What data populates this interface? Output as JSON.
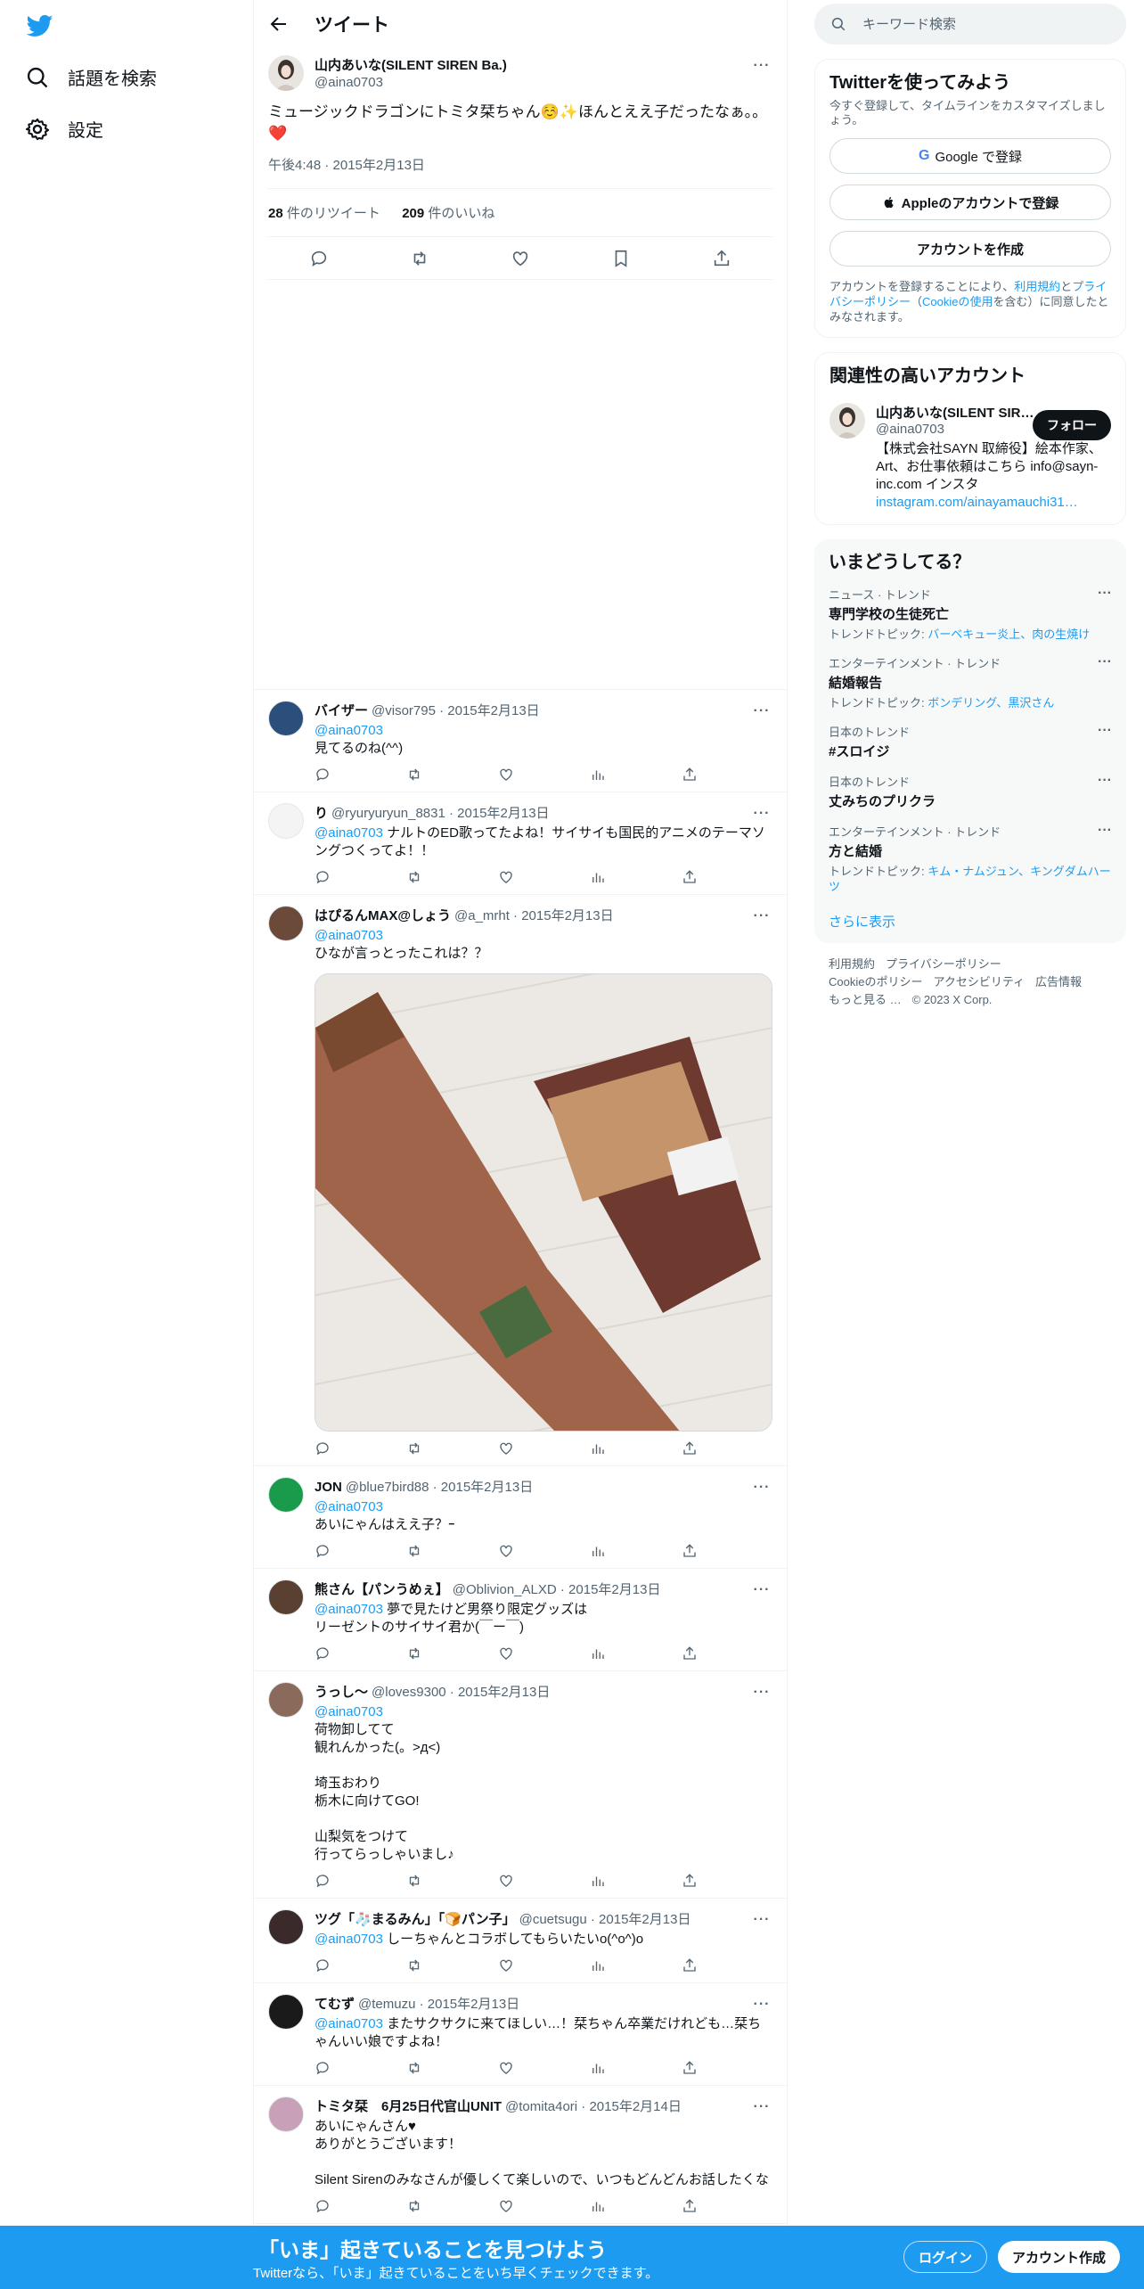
{
  "colors": {
    "accent": "#1d9bf0",
    "text": "#0f1419",
    "secondary": "#536471",
    "border": "#eff3f4"
  },
  "left_nav": {
    "logo": "twitter-bird-icon",
    "items": [
      {
        "label": "話題を検索",
        "icon": "search-icon"
      },
      {
        "label": "設定",
        "icon": "gear-icon"
      }
    ]
  },
  "header": {
    "title": "ツイート"
  },
  "focal_tweet": {
    "name": "山内あいな(SILENT SIREN Ba.)",
    "handle": "@aina0703",
    "text": "ミュージックドラゴンにトミタ栞ちゃん☺️✨ほんとええ子だったなぁ。。❤️",
    "time": "午後4:48 · 2015年2月13日",
    "retweets": "28",
    "retweets_label": " 件のリツイート",
    "likes": "209",
    "likes_label": " 件のいいね"
  },
  "replies": [
    {
      "name": "バイザー",
      "meta": "@visor795 · 2015年2月13日",
      "mention": "@aina0703",
      "text": "見てるのね(^^)",
      "inline": false
    },
    {
      "name": "り",
      "meta": "@ryuryuryun_8831 · 2015年2月13日",
      "mention": "@aina0703",
      "text": " ナルトのED歌ってたよね！サイサイも国民的アニメのテーマソングつくってよ！！",
      "inline": true
    },
    {
      "name": "はぴるんMAX@しょう",
      "meta": "@a_mrht · 2015年2月13日",
      "mention": "@aina0703",
      "text": "ひなが言っとったこれは？？",
      "inline": false,
      "has_photo": true
    },
    {
      "name": "JON",
      "meta": "@blue7bird88 · 2015年2月13日",
      "mention": "@aina0703",
      "text": "あいにゃんはええ子？ｰ",
      "inline": false
    },
    {
      "name": "熊さん【パンうめぇ】",
      "meta": "@Oblivion_ALXD · 2015年2月13日",
      "mention": "@aina0703",
      "text": " 夢で見たけど男祭り限定グッズは\nリーゼントのサイサイ君か(￣ー￣)",
      "inline": true
    },
    {
      "name": "うっし～",
      "meta": "@loves9300 · 2015年2月13日",
      "mention": "@aina0703",
      "text": "荷物卸してて\n観れんかった(。>д<)\n\n埼玉おわり\n栃木に向けてGO!\n\n山梨気をつけて\n行ってらっしゃいまし♪",
      "inline": false
    },
    {
      "name": "ツグ「🧦まるみん」「🍞パン子」",
      "meta": "@cuetsugu · 2015年2月13日",
      "mention": "@aina0703",
      "text": " しーちゃんとコラボしてもらいたいo(^o^)o",
      "inline": true
    },
    {
      "name": "てむず",
      "meta": "@temuzu · 2015年2月13日",
      "mention": "@aina0703",
      "text": " またサクサクに来てほしい…！栞ちゃん卒業だけれども…栞ちゃんいい娘ですよね！",
      "inline": true
    },
    {
      "name": "トミタ栞　6月25日代官山UNIT",
      "meta": "@tomita4ori · 2015年2月14日",
      "mention": "",
      "text": "あいにゃんさん♥\nありがとうございます！\n\nSilent Sirenのみなさんが優しくて楽しいので、いつもどんどんお話したくな",
      "inline": false
    }
  ],
  "search": {
    "placeholder": "キーワード検索"
  },
  "signup_card": {
    "title": "Twitterを使ってみよう",
    "subtitle": "今すぐ登録して、タイムラインをカスタマイズしましょう。",
    "google": "Google で登録",
    "apple": "Appleのアカウントで登録",
    "create": "アカウントを作成",
    "terms_pre": "アカウントを登録することにより、",
    "terms_link1": "利用規約",
    "terms_and": "と",
    "terms_link2": "プライバシーポリシー",
    "terms_paren_open": "（",
    "terms_link3": "Cookieの使用",
    "terms_post": "を含む）に同意したとみなされます。"
  },
  "related": {
    "title": "関連性の高いアカウント",
    "name": "山内あいな(SILENT SIREN Ba.)",
    "handle": "@aina0703",
    "follow": "フォロー",
    "bio": "【株式会社SAYN 取締役】絵本作家、Art、お仕事依頼はこちら info@sayn-inc.com インスタ",
    "bio_link": "instagram.com/ainayamauchi31…"
  },
  "trends": {
    "title": "いまどうしてる？",
    "items": [
      {
        "context": "ニュース · トレンド",
        "title": "専門学校の生徒死亡",
        "topics_label": "トレンドトピック: ",
        "topics": "バーベキュー炎上、肉の生焼け"
      },
      {
        "context": "エンターテインメント · トレンド",
        "title": "結婚報告",
        "topics_label": "トレンドトピック: ",
        "topics": "ボンデリング、黒沢さん"
      },
      {
        "context": "日本のトレンド",
        "title": "#スロイジ",
        "topics_label": "",
        "topics": ""
      },
      {
        "context": "日本のトレンド",
        "title": "丈みちのプリクラ",
        "topics_label": "",
        "topics": ""
      },
      {
        "context": "エンターテインメント · トレンド",
        "title": "方と結婚",
        "topics_label": "トレンドトピック: ",
        "topics": "キム・ナムジュン、キングダムハーツ"
      }
    ],
    "show_more": "さらに表示"
  },
  "footer": {
    "row1": [
      "利用規約",
      "プライバシーポリシー"
    ],
    "row2": [
      "Cookieのポリシー",
      "アクセシビリティ",
      "広告情報"
    ],
    "row3": [
      "もっと見る …",
      "© 2023 X Corp."
    ]
  },
  "bottom_bar": {
    "headline": "「いま」起きていることを見つけよう",
    "sub": "Twitterなら、「いま」起きていることをいち早くチェックできます。",
    "login": "ログイン",
    "signup": "アカウント作成"
  }
}
